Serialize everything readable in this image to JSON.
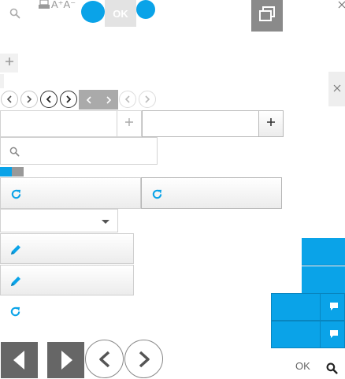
{
  "toolbar": {
    "ok_label": "OK",
    "font_size_label": "A⁺A⁻",
    "colors": {
      "accent": "#0aa3e8",
      "gray": "#888888"
    }
  },
  "bottom_bar": {
    "ok_label": "OK"
  },
  "icons": [
    "search-icon",
    "font-size-icon",
    "restore-window-icon",
    "close-icon",
    "plus-icon",
    "chevron-left-icon",
    "chevron-right-icon",
    "refresh-icon",
    "pencil-icon",
    "dropdown-arrow-icon",
    "comment-icon"
  ]
}
